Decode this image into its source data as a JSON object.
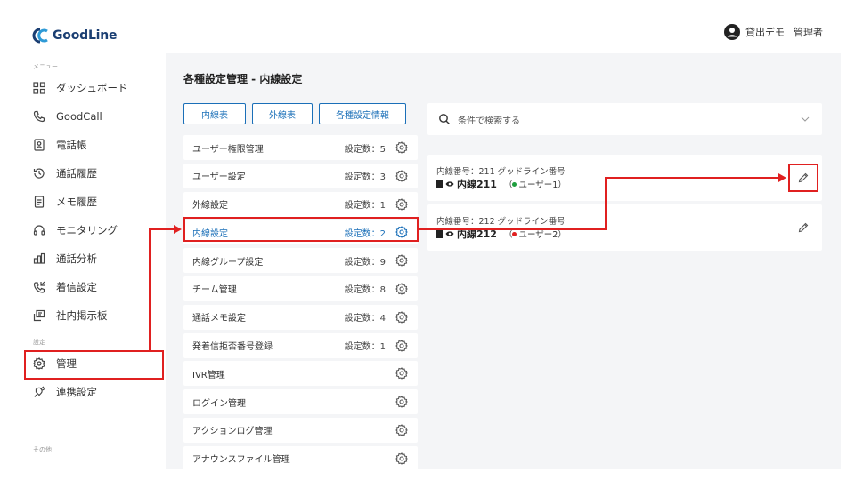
{
  "header": {
    "brand": "GoodLine",
    "user_name": "貸出デモ",
    "user_role": "管理者"
  },
  "sidebar": {
    "section_menu": "メニュー",
    "section_settings": "設定",
    "section_other": "その他",
    "items": [
      {
        "label": "ダッシュボード",
        "icon": "dashboard-icon"
      },
      {
        "label": "GoodCall",
        "icon": "phone-icon"
      },
      {
        "label": "電話帳",
        "icon": "phonebook-icon"
      },
      {
        "label": "通話履歴",
        "icon": "history-icon"
      },
      {
        "label": "メモ履歴",
        "icon": "memo-icon"
      },
      {
        "label": "モニタリング",
        "icon": "headset-icon"
      },
      {
        "label": "通話分析",
        "icon": "chart-icon"
      },
      {
        "label": "着信設定",
        "icon": "incoming-call-icon"
      },
      {
        "label": "社内掲示板",
        "icon": "board-icon"
      }
    ],
    "settings_items": [
      {
        "label": "管理",
        "icon": "gear-icon"
      },
      {
        "label": "連携設定",
        "icon": "plug-icon"
      }
    ]
  },
  "main": {
    "title": "各種設定管理 - 内線設定",
    "tabs": [
      "内線表",
      "外線表",
      "各種設定情報"
    ],
    "settings": [
      {
        "name": "ユーザー権限管理",
        "count": "設定数：5"
      },
      {
        "name": "ユーザー設定",
        "count": "設定数：3"
      },
      {
        "name": "外線設定",
        "count": "設定数：1"
      },
      {
        "name": "内線設定",
        "count": "設定数：2"
      },
      {
        "name": "内線グループ設定",
        "count": "設定数：9"
      },
      {
        "name": "チーム管理",
        "count": "設定数：8"
      },
      {
        "name": "通話メモ設定",
        "count": "設定数：4"
      },
      {
        "name": "発着信拒否番号登録",
        "count": "設定数：1"
      },
      {
        "name": "IVR管理",
        "count": ""
      },
      {
        "name": "ログイン管理",
        "count": ""
      },
      {
        "name": "アクションログ管理",
        "count": ""
      },
      {
        "name": "アナウンスファイル管理",
        "count": ""
      }
    ],
    "search_placeholder": "条件で検索する",
    "extensions": [
      {
        "line1": "内線番号：211 グッドライン番号",
        "name": "内線211",
        "status": "ユーザー1",
        "status_color": "#1e9e3e"
      },
      {
        "line1": "内線番号：212 グッドライン番号",
        "name": "内線212",
        "status": "ユーザー2",
        "status_color": "#e02020"
      }
    ]
  },
  "colors": {
    "accent": "#1a6fb8",
    "annotation": "#e02020",
    "panel_bg": "#f4f5f7"
  }
}
